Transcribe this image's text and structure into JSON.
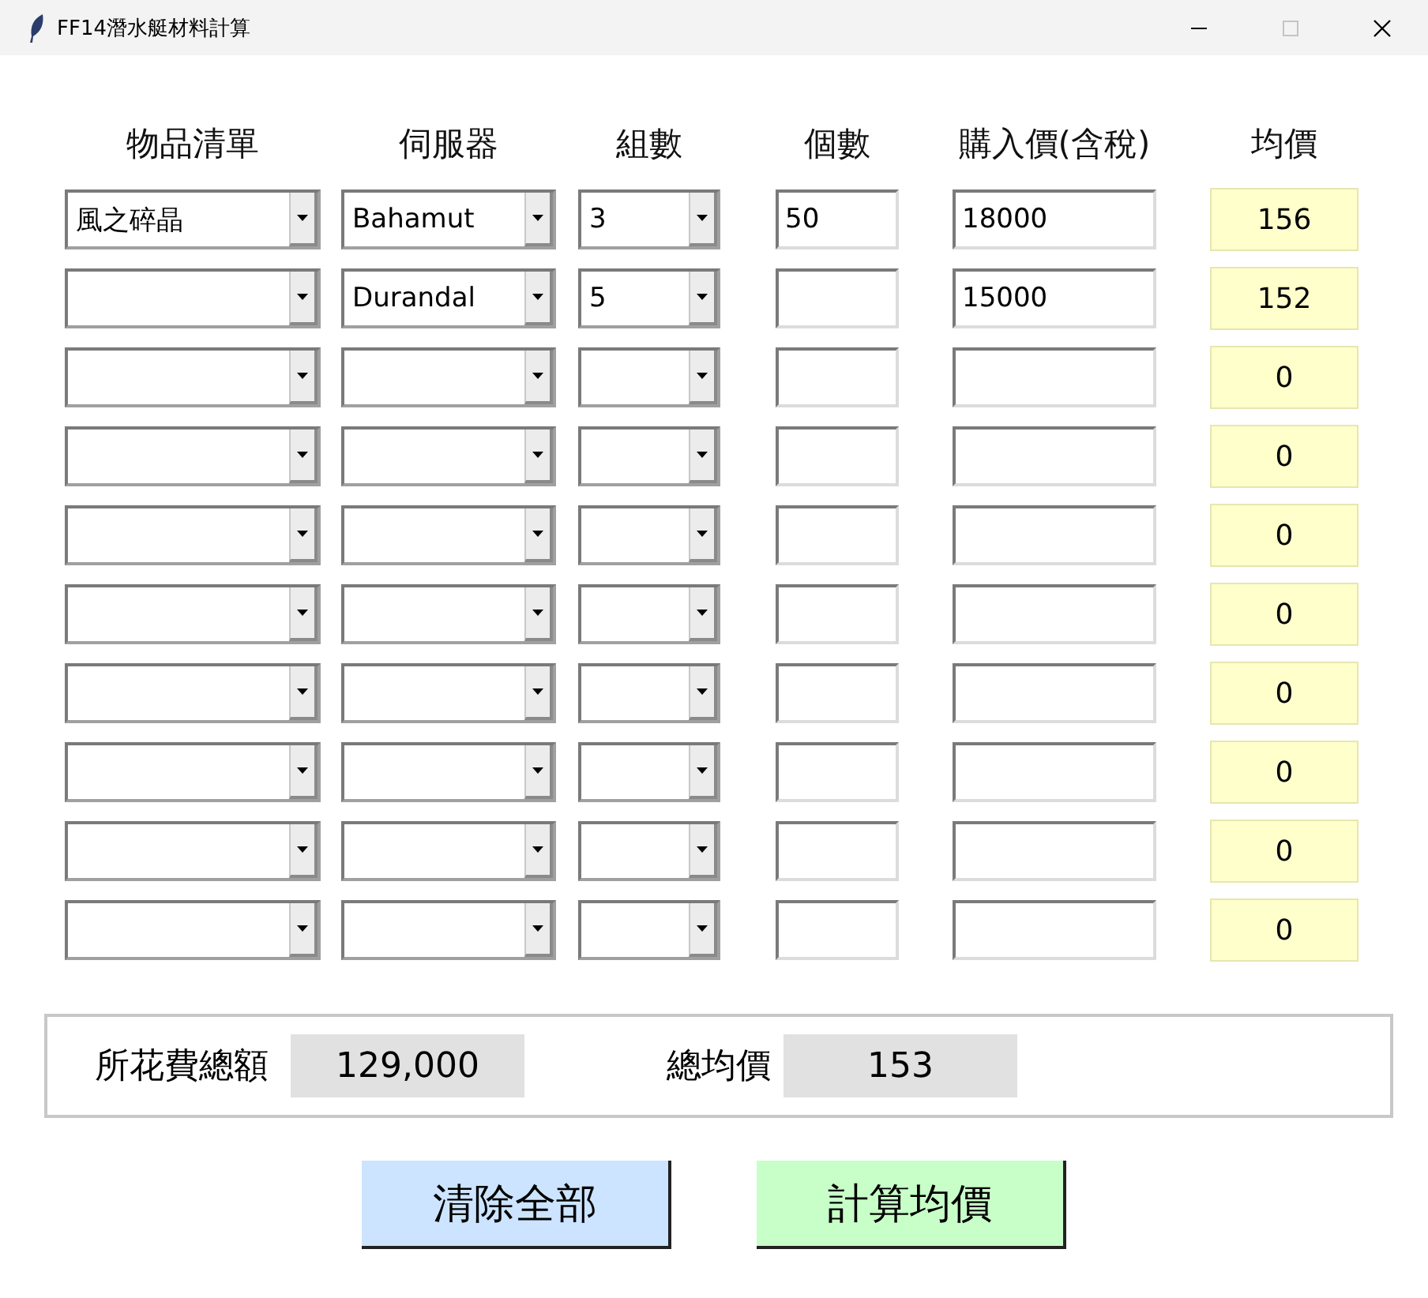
{
  "window": {
    "title": "FF14潛水艇材料計算",
    "controls": [
      {
        "kind": "minimize",
        "disabled": false
      },
      {
        "kind": "maximize",
        "disabled": true
      },
      {
        "kind": "close",
        "disabled": false
      }
    ]
  },
  "columns": [
    "物品清單",
    "伺服器",
    "組數",
    "個數",
    "購入價(含稅)",
    "均價"
  ],
  "rows": [
    {
      "item": "風之碎晶",
      "server": "Bahamut",
      "sets": "3",
      "count": "50",
      "price": "18000",
      "average": "156"
    },
    {
      "server": "Durandal",
      "sets": "5",
      "price": "15000",
      "average": "152"
    },
    {
      "average": "0"
    },
    {
      "average": "0"
    },
    {
      "average": "0"
    },
    {
      "average": "0"
    },
    {
      "average": "0"
    },
    {
      "average": "0"
    },
    {
      "average": "0"
    },
    {
      "average": "0"
    }
  ],
  "summary": {
    "total_label": "所花費總額",
    "total_value": "129,000",
    "average_label": "總均價",
    "average_value": "153"
  },
  "buttons": [
    {
      "label": "清除全部",
      "kind": "clear"
    },
    {
      "label": "計算均價",
      "kind": "calculate"
    }
  ]
}
